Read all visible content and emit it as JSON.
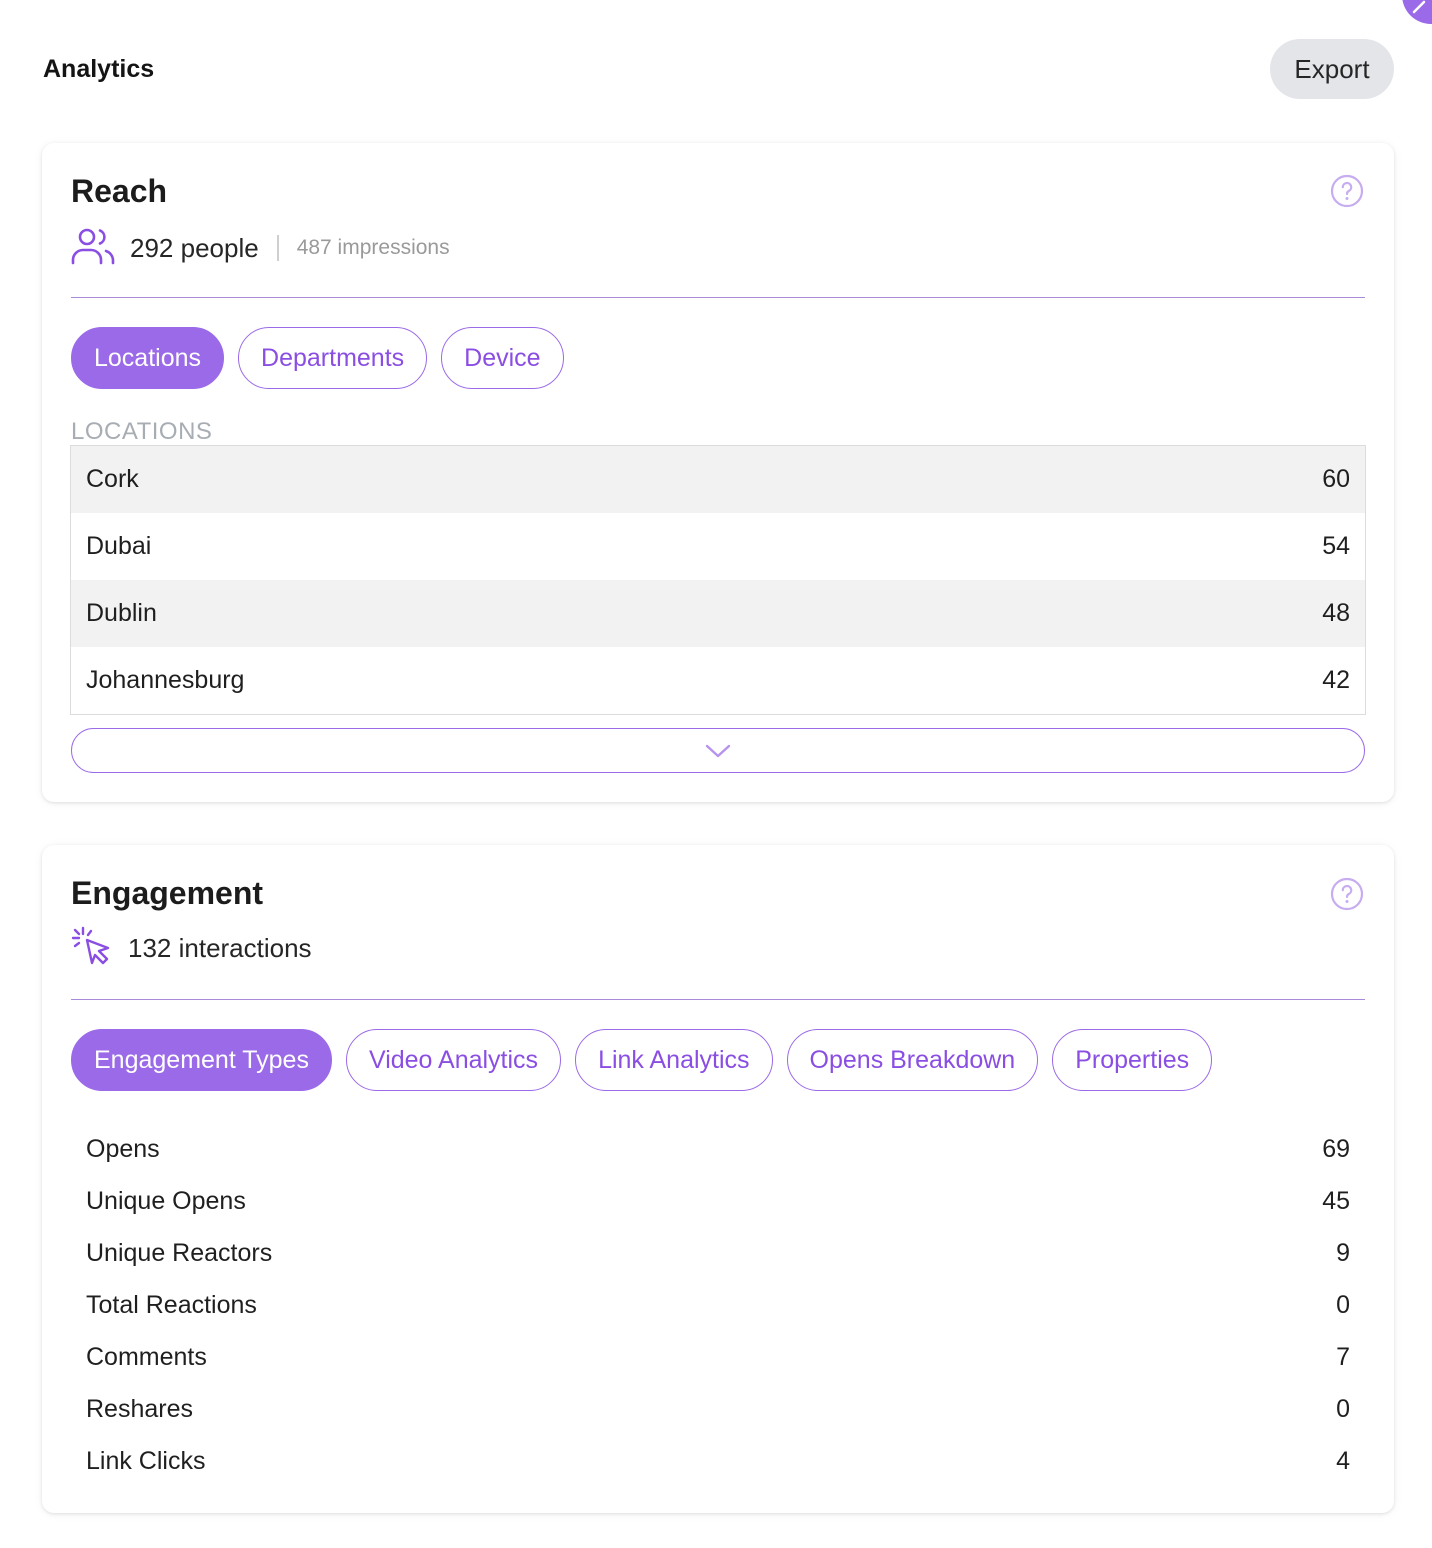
{
  "header": {
    "title": "Analytics",
    "export_label": "Export"
  },
  "reach": {
    "title": "Reach",
    "people": "292 people",
    "impressions": "487 impressions",
    "tabs": [
      {
        "label": "Locations",
        "active": true
      },
      {
        "label": "Departments",
        "active": false
      },
      {
        "label": "Device",
        "active": false
      }
    ],
    "section_label": "LOCATIONS",
    "locations": [
      {
        "name": "Cork",
        "count": "60"
      },
      {
        "name": "Dubai",
        "count": "54"
      },
      {
        "name": "Dublin",
        "count": "48"
      },
      {
        "name": "Johannesburg",
        "count": "42"
      }
    ]
  },
  "engagement": {
    "title": "Engagement",
    "interactions": "132 interactions",
    "tabs": [
      {
        "label": "Engagement Types",
        "active": true
      },
      {
        "label": "Video Analytics",
        "active": false
      },
      {
        "label": "Link Analytics",
        "active": false
      },
      {
        "label": "Opens Breakdown",
        "active": false
      },
      {
        "label": "Properties",
        "active": false
      }
    ],
    "metrics": [
      {
        "label": "Opens",
        "value": "69"
      },
      {
        "label": "Unique Opens",
        "value": "45"
      },
      {
        "label": "Unique Reactors",
        "value": "9"
      },
      {
        "label": "Total Reactions",
        "value": "0"
      },
      {
        "label": "Comments",
        "value": "7"
      },
      {
        "label": "Reshares",
        "value": "0"
      },
      {
        "label": "Link Clicks",
        "value": "4"
      }
    ]
  },
  "colors": {
    "accent": "#9b6ae8",
    "accent_text": "#8a4ee3",
    "row_shade": "#f2f2f2",
    "export_bg": "#e3e5e8"
  },
  "icons": {
    "reach": "people-icon",
    "engagement": "click-cursor-icon",
    "help": "help-circle-icon",
    "expand": "chevron-down-icon"
  }
}
